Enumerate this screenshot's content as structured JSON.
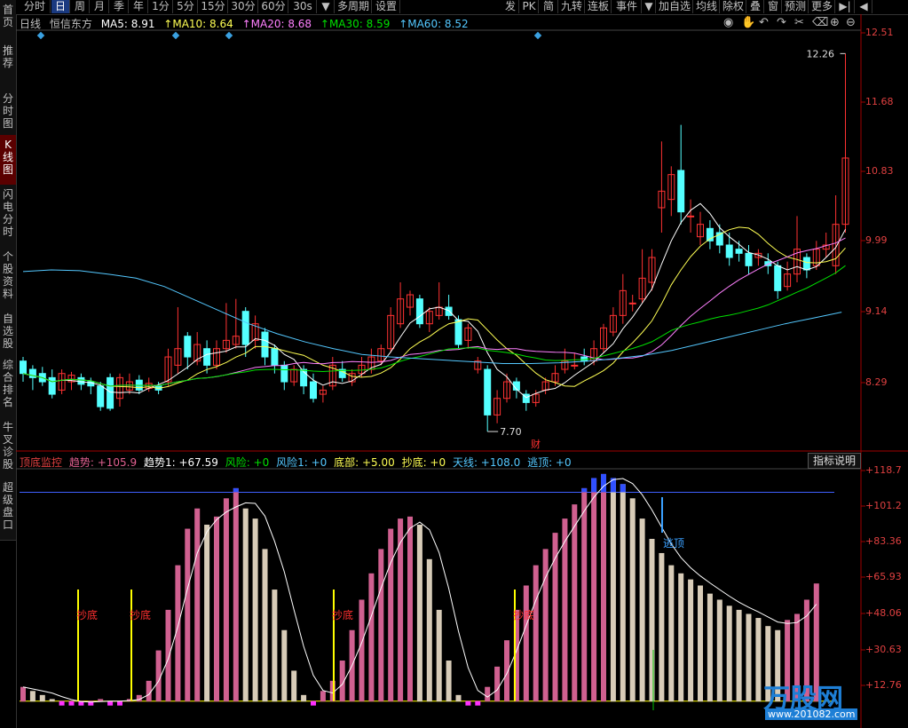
{
  "sidebar": [
    {
      "label": "首页",
      "active": false
    },
    {
      "label": "推荐",
      "active": false
    },
    {
      "label": "分时图",
      "active": false
    },
    {
      "label": "K线图",
      "active": true
    },
    {
      "label": "闪电分时",
      "active": false
    },
    {
      "label": "个股资料",
      "active": false
    },
    {
      "label": "自选股",
      "active": false
    },
    {
      "label": "综合排名",
      "active": false
    },
    {
      "label": "牛叉诊股",
      "active": false
    },
    {
      "label": "超级盘口",
      "active": false
    }
  ],
  "toolbar_left": [
    "分时",
    "日",
    "周",
    "月",
    "季",
    "年",
    "1分",
    "5分",
    "15分",
    "30分",
    "60分",
    "30s",
    "▼",
    "多周期",
    "设置"
  ],
  "toolbar_active": "日",
  "toolbar_right": [
    "发",
    "PK",
    "简",
    "九转",
    "连板",
    "事件",
    "▼",
    "加自选",
    "均线",
    "除权",
    "叠",
    "窗",
    "预测",
    "更多",
    "▶|",
    "◀"
  ],
  "info": {
    "period": "日线",
    "stock": "恒信东方",
    "ma5": "MA5: 8.91",
    "ma10": "↑MA10: 8.64",
    "ma20": "↑MA20: 8.68",
    "ma30": "↑MA30: 8.59",
    "ma60": "↑MA60: 8.52"
  },
  "colors": {
    "up": "#ff3232",
    "down": "#54ffff",
    "ma5": "#ffffff",
    "ma10": "#ffff54",
    "ma20": "#ff80ff",
    "ma30": "#00e000",
    "ma60": "#54c8ff",
    "pink": "#d06090",
    "beige": "#d8ccb8",
    "yellow": "#ffff00",
    "blue": "#3050ff"
  },
  "price_axis": [
    "12.51",
    "11.68",
    "10.83",
    "9.99",
    "9.14",
    "8.29"
  ],
  "price_markers": {
    "high": "12.26",
    "low": "7.70",
    "finance": "财"
  },
  "indicator": {
    "name": "顶底监控",
    "trend": "趋势: +105.9",
    "trend1": "趋势1: +67.59",
    "risk": "风险: +0",
    "risk1": "风险1: +0",
    "bottom": "底部: +5.00",
    "chaodi": "抄底: +0",
    "tianxian": "天线: +108.0",
    "taoding": "逃顶: +0",
    "button": "指标说明"
  },
  "ind_axis": [
    "+118.7",
    "+101.2",
    "+83.36",
    "+65.93",
    "+48.06",
    "+30.63",
    "+12.76"
  ],
  "signals": {
    "chaodi": "抄底",
    "taoding": "逃顶"
  },
  "watermark": {
    "text": "万股网",
    "url": "www.201082.com"
  }
}
